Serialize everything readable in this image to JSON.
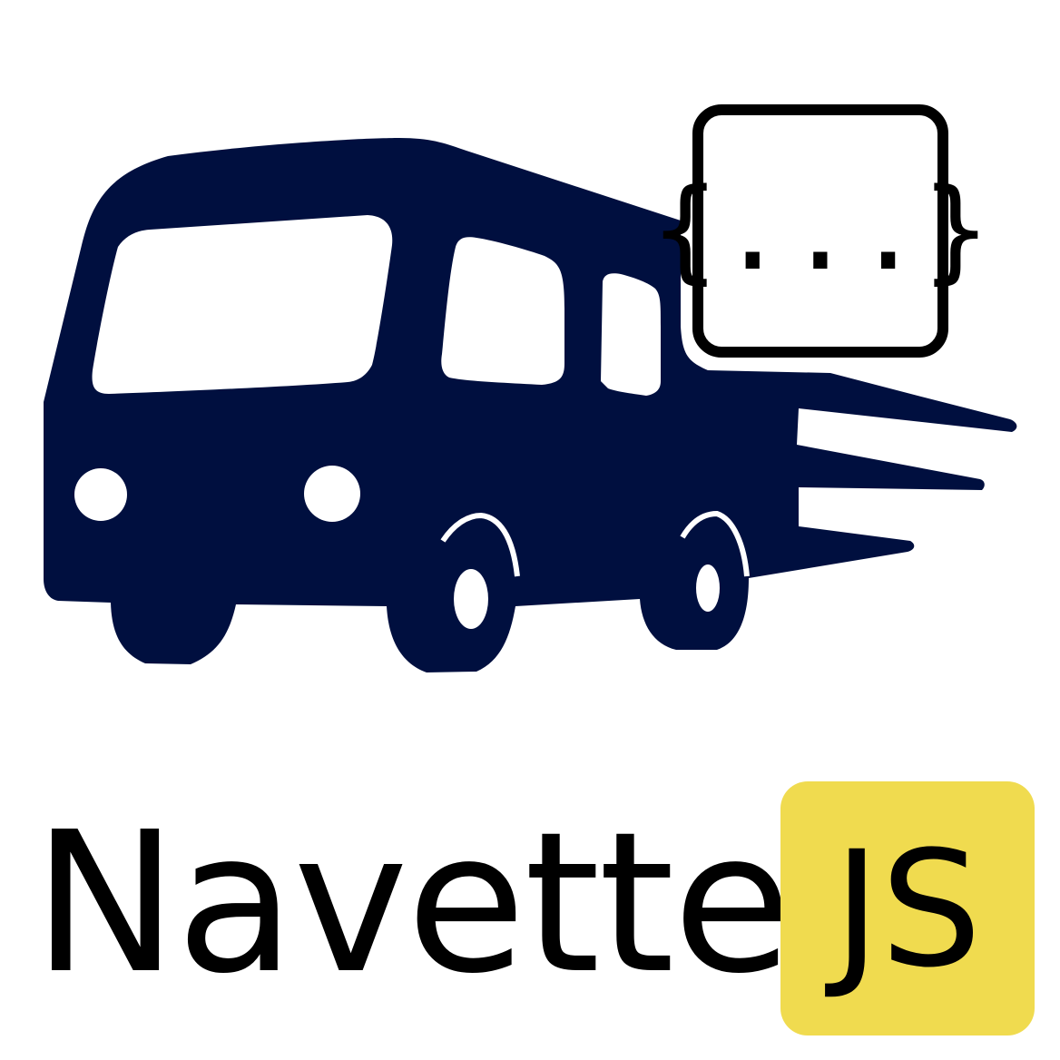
{
  "logo": {
    "name": "Navette",
    "badge_text": "JS",
    "code_symbol": "{...}",
    "icons": [
      "shuttle-van-icon",
      "json-braces-icon"
    ]
  },
  "colors": {
    "van": "#000f3f",
    "badge_background": "#f0db4f",
    "text": "#000000",
    "background": "#ffffff"
  }
}
